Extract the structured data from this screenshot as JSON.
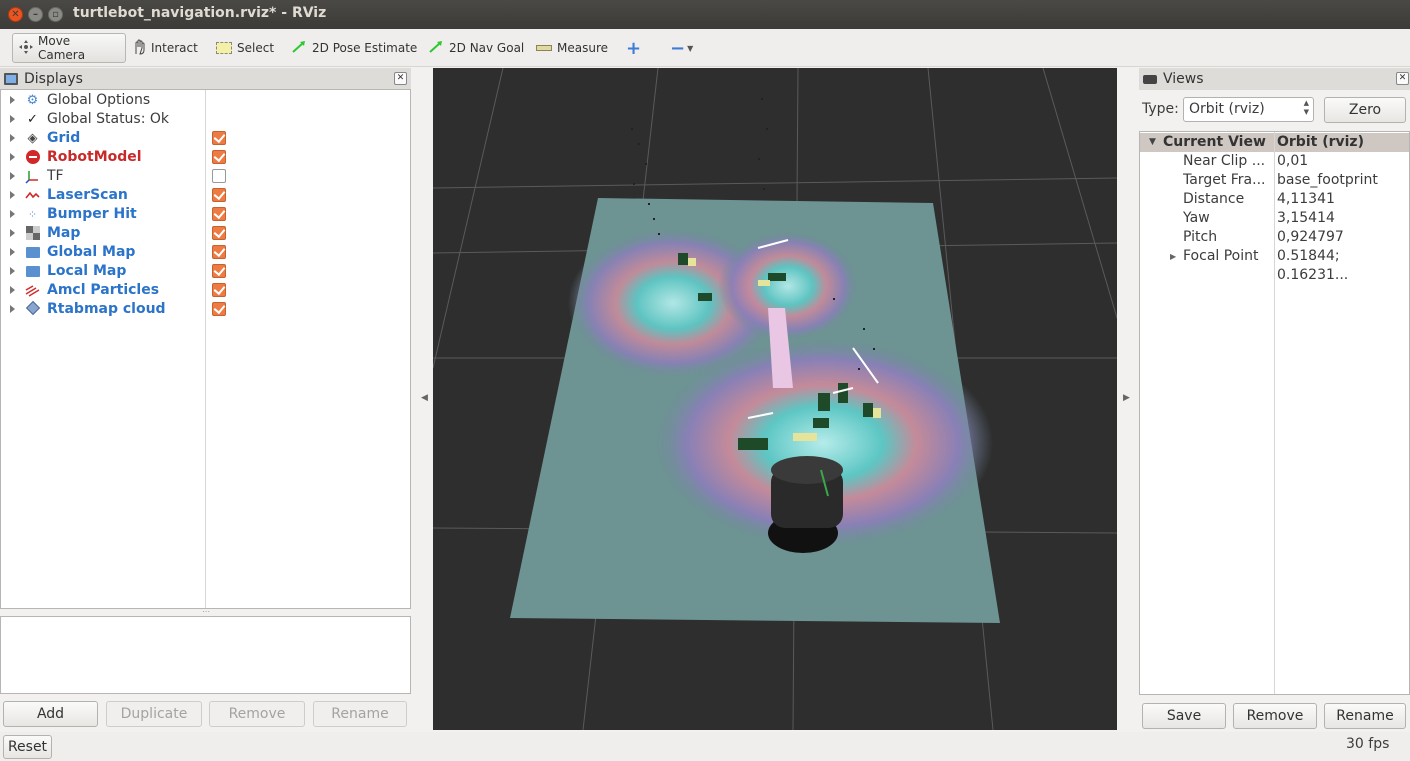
{
  "window": {
    "title": "turtlebot_navigation.rviz* - RViz"
  },
  "toolbar": {
    "move_camera": "Move Camera",
    "interact": "Interact",
    "select": "Select",
    "pose_estimate": "2D Pose Estimate",
    "nav_goal": "2D Nav Goal",
    "measure": "Measure"
  },
  "displays": {
    "title": "Displays",
    "items": [
      {
        "label": "Global Options",
        "style": "normal",
        "checked": null
      },
      {
        "label": "Global Status: Ok",
        "style": "normal",
        "checked": null
      },
      {
        "label": "Grid",
        "style": "blue",
        "checked": true
      },
      {
        "label": "RobotModel",
        "style": "red",
        "checked": true
      },
      {
        "label": "TF",
        "style": "normal",
        "checked": false
      },
      {
        "label": "LaserScan",
        "style": "blue",
        "checked": true
      },
      {
        "label": "Bumper Hit",
        "style": "blue",
        "checked": true
      },
      {
        "label": "Map",
        "style": "blue",
        "checked": true
      },
      {
        "label": "Global Map",
        "style": "blue",
        "checked": true
      },
      {
        "label": "Local Map",
        "style": "blue",
        "checked": true
      },
      {
        "label": "Amcl Particles",
        "style": "blue",
        "checked": true
      },
      {
        "label": "Rtabmap cloud",
        "style": "blue",
        "checked": true
      }
    ],
    "buttons": {
      "add": "Add",
      "duplicate": "Duplicate",
      "remove": "Remove",
      "rename": "Rename"
    }
  },
  "views": {
    "title": "Views",
    "type_label": "Type:",
    "type_value": "Orbit (rviz)",
    "zero": "Zero",
    "header_key": "Current View",
    "header_value": "Orbit (rviz)",
    "props": [
      {
        "key": "Near Clip ...",
        "value": "0,01"
      },
      {
        "key": "Target Fra...",
        "value": "base_footprint"
      },
      {
        "key": "Distance",
        "value": "4,11341"
      },
      {
        "key": "Yaw",
        "value": "3,15414"
      },
      {
        "key": "Pitch",
        "value": "0,924797"
      },
      {
        "key": "Focal Point",
        "value": "0.51844; 0.16231..."
      }
    ],
    "buttons": {
      "save": "Save",
      "remove": "Remove",
      "rename": "Rename"
    }
  },
  "status": {
    "reset": "Reset",
    "fps": "30 fps"
  },
  "colors": {
    "accent": "#e95420",
    "checkbox": "#ee7b43",
    "link_blue": "#2b74c9",
    "error_red": "#c82a2a"
  }
}
